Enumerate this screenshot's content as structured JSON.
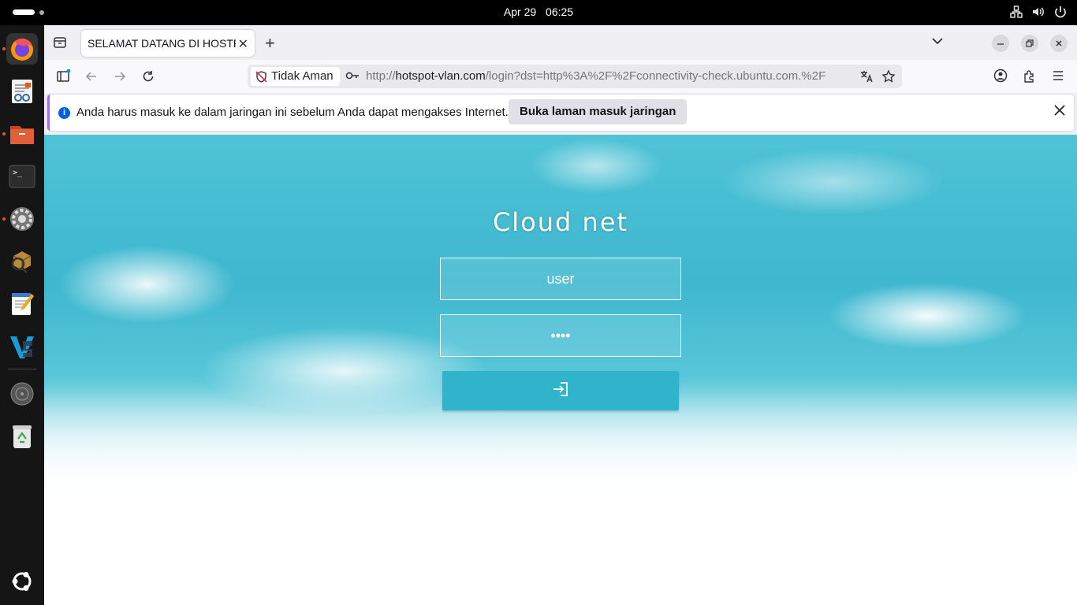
{
  "topbar": {
    "date": "Apr 29",
    "time": "06:25"
  },
  "dock": {
    "items": [
      "firefox-icon",
      "document-viewer-icon",
      "files-icon",
      "terminal-icon",
      "settings-icon",
      "package-manager-icon",
      "text-editor-icon",
      "vscode-icon",
      "disk-icon",
      "trash-icon",
      "ubuntu-apps-icon"
    ]
  },
  "browser": {
    "tab_title": "SELAMAT DATANG DI HOSTP",
    "url_security_label": "Tidak Aman",
    "url_host": "hotspot-vlan.com",
    "url_prefix": "http://",
    "url_path": "/login?dst=http%3A%2F%2Fconnectivity-check.ubuntu.com.%2F"
  },
  "infobar": {
    "message": "Anda harus masuk ke dalam jaringan ini sebelum Anda dapat mengakses Internet.",
    "button_label": "Buka laman masuk jaringan"
  },
  "page": {
    "brand": "Cloud net",
    "username_value": "user",
    "password_value": "••••"
  },
  "colors": {
    "accent": "#2fb4cc",
    "sky": "#3eb7cf"
  }
}
